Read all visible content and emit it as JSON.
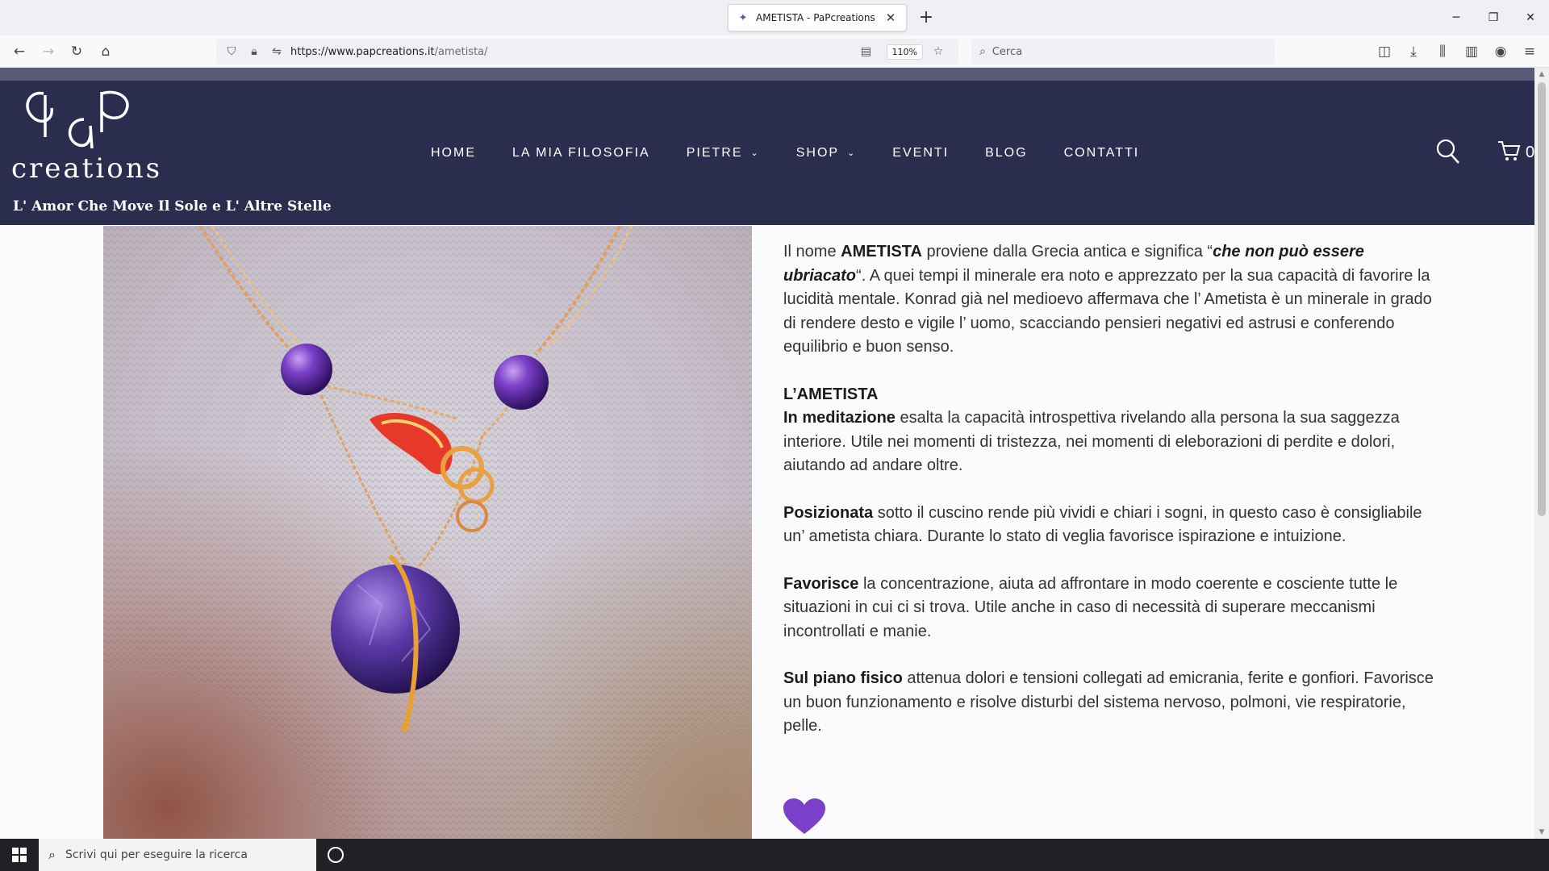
{
  "browser": {
    "tab_title": "AMETISTA - PaPcreations",
    "url_domain": "https://www.papcreations.it",
    "url_path": "/ametista/",
    "zoom": "110%",
    "search_placeholder": "Cerca"
  },
  "site": {
    "tagline": "L' Amor Che Move Il Sole e L' Altre Stelle",
    "logo_text": "creations",
    "logo_letters": "PaP",
    "menu": [
      {
        "label": "HOME",
        "dropdown": false
      },
      {
        "label": "LA MIA FILOSOFIA",
        "dropdown": false
      },
      {
        "label": "PIETRE",
        "dropdown": true
      },
      {
        "label": "SHOP",
        "dropdown": true
      },
      {
        "label": "EVENTI",
        "dropdown": false
      },
      {
        "label": "BLOG",
        "dropdown": false
      },
      {
        "label": "CONTATTI",
        "dropdown": false
      }
    ],
    "cart_count": "0"
  },
  "article": {
    "p1_pre": "Il nome ",
    "p1_b1": "AMETISTA",
    "p1_mid": " proviene dalla Grecia antica e significa “",
    "p1_em": "che non può essere ubriacato",
    "p1_post": "“. A quei tempi il minerale era noto e apprezzato per la sua capacità di favorire la lucidità mentale. Konrad già nel medioevo affermava che l’ Ametista è un minerale in grado di rendere desto e vigile l’ uomo, scacciando pensieri negativi ed astrusi e conferendo equilibrio e buon senso.",
    "heading": "L’AMETISTA",
    "p2_b": "In meditazione",
    "p2_text": " esalta la capacità introspettiva rivelando alla persona la sua saggezza interiore. Utile nei momenti di tristezza, nei momenti di eleborazioni di perdite e dolori, aiutando ad andare oltre.",
    "p3_b": "Posizionata",
    "p3_text": " sotto il cuscino rende più vividi e chiari i sogni, in questo caso è consigliabile un’ ametista chiara. Durante lo stato di veglia favorisce  ispirazione e intuizione.",
    "p4_b": "Favorisce",
    "p4_text": " la concentrazione, aiuta ad affrontare in modo coerente e cosciente tutte le situazioni in cui ci si trova. Utile anche in caso di necessità di superare meccanismi incontrollati e manie.",
    "p5_b": "Sul piano fisico",
    "p5_text": " attenua dolori e tensioni collegati ad emicrania, ferite e gonfiori. Favorisce un buon funzionamento e risolve disturbi  del sistema nervoso, polmoni, vie respiratorie, pelle."
  },
  "taskbar": {
    "search_placeholder": "Scrivi qui per eseguire la ricerca"
  },
  "colors": {
    "header_bg": "#2b2d4e",
    "accent_purple": "#7b3fc9"
  }
}
